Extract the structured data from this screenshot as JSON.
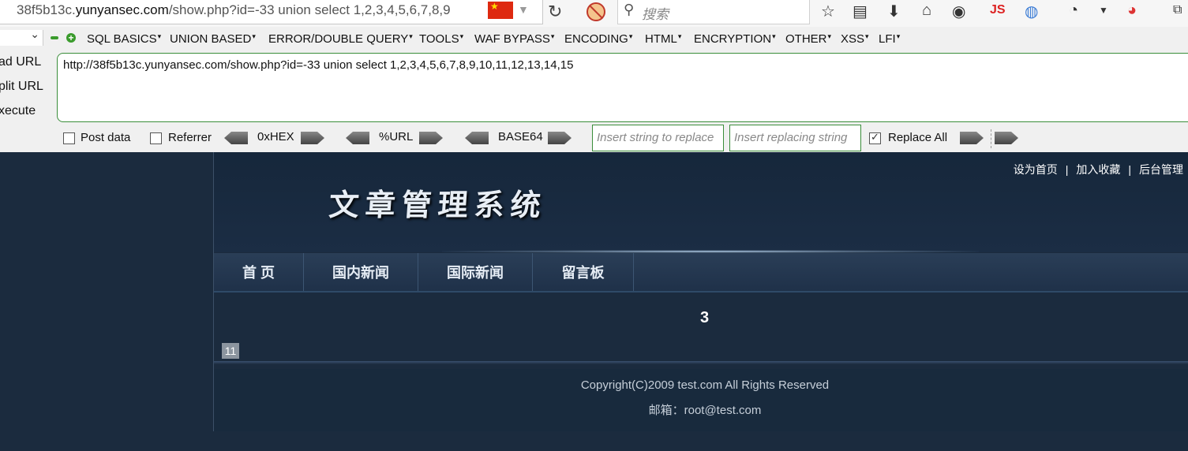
{
  "browser": {
    "url_prefix": "38f5b13c.",
    "url_domain": "yunyansec.com",
    "url_suffix": "/show.php?id=-33 union select 1,2,3,4,5,6,7,8,9",
    "search_placeholder": "搜索",
    "toolbar_js_label": "JS"
  },
  "hackbar": {
    "menu": [
      "SQL BASICS",
      "UNION BASED",
      "ERROR/DOUBLE QUERY",
      "TOOLS",
      "WAF BYPASS",
      "ENCODING",
      "HTML",
      "ENCRYPTION",
      "OTHER",
      "XSS",
      "LFI"
    ],
    "side_buttons": [
      "ad URL",
      "plit URL",
      "xecute"
    ],
    "query": "http://38f5b13c.yunyansec.com/show.php?id=-33 union select 1,2,3,4,5,6,7,8,9,10,11,12,13,14,15",
    "post_data_label": "Post data",
    "referrer_label": "Referrer",
    "hex_label": "0xHEX",
    "url_label": "%URL",
    "base64_label": "BASE64",
    "replace_placeholder": "Insert string to replace",
    "replacing_placeholder": "Insert replacing string",
    "replace_all_label": "Replace All",
    "post_data_checked": false,
    "referrer_checked": false,
    "replace_all_checked": true
  },
  "site": {
    "toplinks": [
      "设为首页",
      "加入收藏",
      "后台管理"
    ],
    "toplink_sep": "|",
    "title": "文章管理系统",
    "nav": [
      "首 页",
      "国内新闻",
      "国际新闻",
      "留言板"
    ],
    "content_number": "3",
    "badge": "11",
    "copyright": "Copyright(C)2009 test.com All Rights Reserved",
    "email": "邮箱：root@test.com"
  }
}
